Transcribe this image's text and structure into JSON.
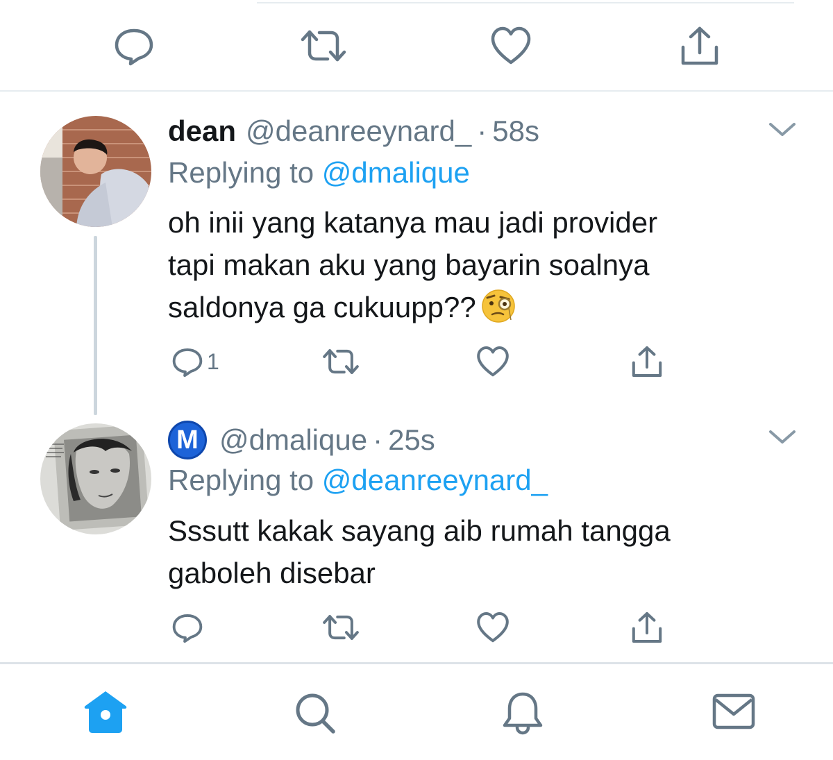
{
  "tweets": [
    {
      "display_name": "dean",
      "handle": "@deanreeynard_",
      "separator": "·",
      "time": "58s",
      "replying_prefix": "Replying to",
      "replying_to": "@dmalique",
      "lines": [
        "oh inii yang katanya mau jadi provider",
        "tapi makan aku yang bayarin soalnya",
        "saldonya ga cukuupp??"
      ],
      "emoji": "face-with-monocle",
      "reply_count": "1"
    },
    {
      "display_name": "",
      "badge_letter": "M",
      "handle": "@dmalique",
      "separator": "·",
      "time": "25s",
      "replying_prefix": "Replying to",
      "replying_to": "@deanreeynard_",
      "lines": [
        "Sssutt kakak sayang aib rumah tangga",
        "gaboleh disebar"
      ],
      "reply_count": ""
    }
  ],
  "icons": {
    "reply": "reply-icon",
    "retweet": "retweet-icon",
    "like": "like-icon",
    "share": "share-icon",
    "more": "chevron-down-icon"
  },
  "tabbar": [
    "home-icon",
    "search-icon",
    "notifications-icon",
    "messages-icon"
  ],
  "colors": {
    "accent": "#1da1f2",
    "muted": "#657786",
    "icon": "#657786",
    "divider": "#e6ecf0",
    "badge": "#1d63d8"
  }
}
